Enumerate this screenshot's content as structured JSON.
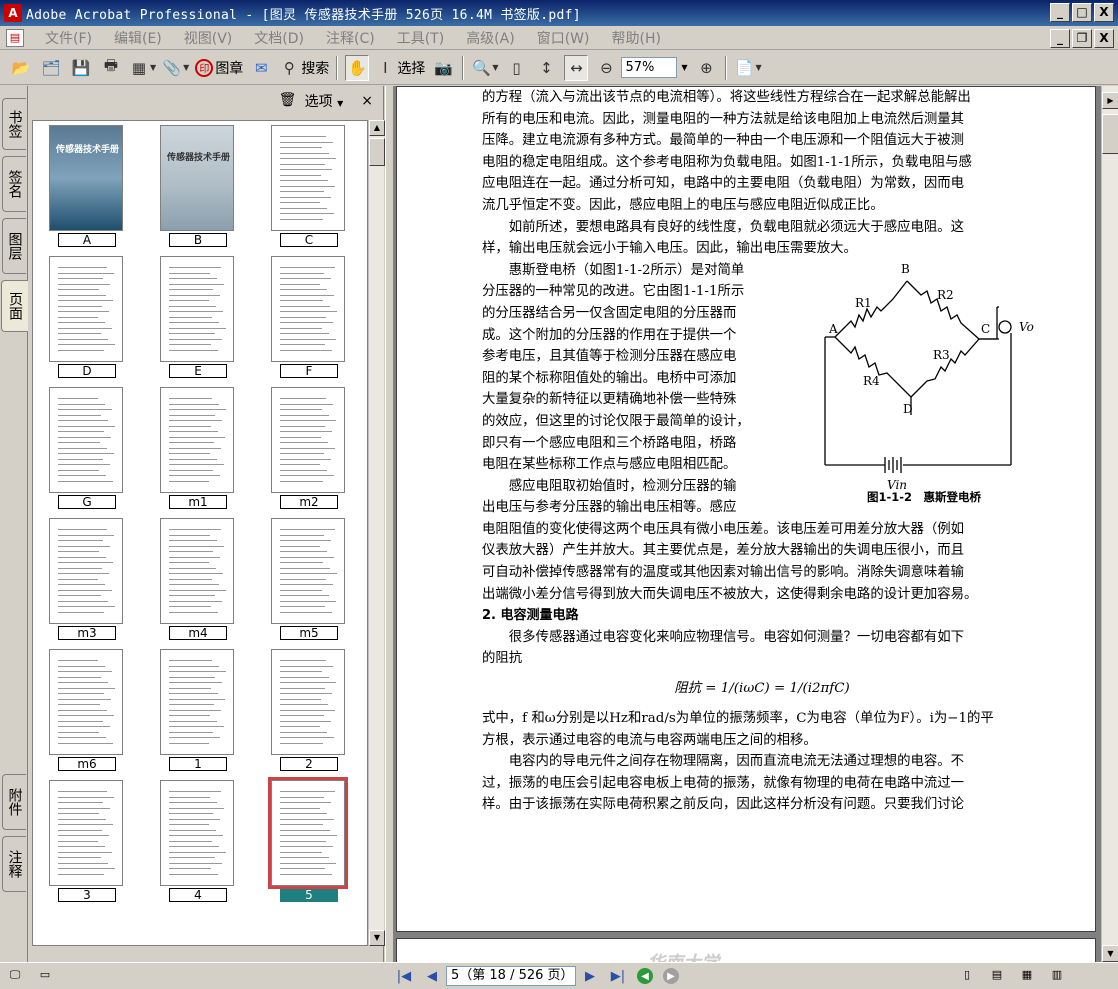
{
  "window": {
    "title": "Adobe Acrobat Professional - [图灵 传感器技术手册 526页 16.4M 书签版.pdf]",
    "minimize": "_",
    "maximize": "□",
    "close": "X",
    "doc_minimize": "_",
    "doc_restore": "❐",
    "doc_close": "X"
  },
  "menu": {
    "items": [
      "文件(F)",
      "编辑(E)",
      "视图(V)",
      "文档(D)",
      "注释(C)",
      "工具(T)",
      "高级(A)",
      "窗口(W)",
      "帮助(H)"
    ]
  },
  "toolbar": {
    "stamp_label": "图章",
    "search_label": "搜索",
    "select_label": "选择",
    "zoom_value": "57%"
  },
  "left_tabs": {
    "bookmarks": "书签",
    "signatures": "签名",
    "layers": "图层",
    "pages": "页面",
    "attachments": "附件",
    "comments": "注释"
  },
  "pages_panel": {
    "options_label": "选项",
    "close": "×",
    "cover_title": "传感器技术手册",
    "thumbnails": [
      "A",
      "B",
      "C",
      "D",
      "E",
      "F",
      "G",
      "m1",
      "m2",
      "m3",
      "m4",
      "m5",
      "m6",
      "1",
      "2",
      "3",
      "4",
      "5"
    ],
    "selected": "5"
  },
  "document": {
    "lines_top": [
      "的方程（流入与流出该节点的电流相等）。将这些线性方程综合在一起求解总能解出",
      "所有的电压和电流。因此，测量电阻的一种方法就是给该电阻加上电流然后测量其",
      "压降。建立电流源有多种方式。最简单的一种由一个电压源和一个阻值远大于被测",
      "电阻的稳定电阻组成。这个参考电阻称为负载电阻。如图1-1-1所示，负载电阻与感",
      "应电阻连在一起。通过分析可知，电路中的主要电阻（负载电阻）为常数，因而电",
      "流几乎恒定不变。因此，感应电阻上的电压与感应电阻近似成正比。",
      "　　如前所述，要想电路具有良好的线性度，负载电阻就必须远大于感应电阻。这",
      "样，输出电压就会远小于输入电压。因此，输出电压需要放大。"
    ],
    "lines_left": [
      "　　惠斯登电桥（如图1-1-2所示）是对简单",
      "分压器的一种常见的改进。它由图1-1-1所示",
      "的分压器结合另一仅含固定电阻的分压器而",
      "成。这个附加的分压器的作用在于提供一个",
      "参考电压，且其值等于检测分压器在感应电",
      "阻的某个标称阻值处的输出。电桥中可添加",
      "大量复杂的新特征以更精确地补偿一些特殊",
      "的效应，但这里的讨论仅限于最简单的设计，",
      "即只有一个感应电阻和三个桥路电阻，桥路",
      "电阻在某些标称工作点与感应电阻相匹配。",
      "　　感应电阻取初始值时，检测分压器的输",
      "出电压与参考分压器的输出电压相等。感应"
    ],
    "lines_bottom": [
      "电阻阻值的变化使得这两个电压具有微小电压差。该电压差可用差分放大器（例如",
      "仪表放大器）产生并放大。其主要优点是，差分放大器输出的失调电压很小，而且",
      "可自动补偿掉传感器常有的温度或其他因素对输出信号的影响。消除失调意味着输",
      "出端微小差分信号得到放大而失调电压不被放大，这使得剩余电路的设计更加容易。"
    ],
    "heading": "2. 电容测量电路",
    "lines_after_heading": [
      "　　很多传感器通过电容变化来响应物理信号。电容如何测量？一切电容都有如下",
      "的阻抗"
    ],
    "formula": "阻抗 = 1/(iωC) = 1/(i2πfC)",
    "lines_end": [
      "式中，f 和ω分别是以Hz和rad/s为单位的振荡频率，C为电容（单位为F）。i为−1的平",
      "方根，表示通过电容的电流与电容两端电压之间的相移。",
      "　　电容内的导电元件之间存在物理隔离，因而直流电流无法通过理想的电容。不",
      "过，振荡的电压会引起电容电板上电荷的振荡，就像有物理的电荷在电路中流过一",
      "样。由于该振荡在实际电荷积累之前反向，因此这样分析没有问题。只要我们讨论"
    ],
    "figure": {
      "nodes": [
        "A",
        "B",
        "C",
        "D"
      ],
      "resistors": [
        "R1",
        "R2",
        "R3",
        "R4"
      ],
      "vo": "Vo",
      "vin": "Vin",
      "caption": "图1-1-2　惠斯登电桥"
    },
    "next_page_header": "华南大学..."
  },
  "statusbar": {
    "page_field": "5（第 18 / 526 页）"
  }
}
